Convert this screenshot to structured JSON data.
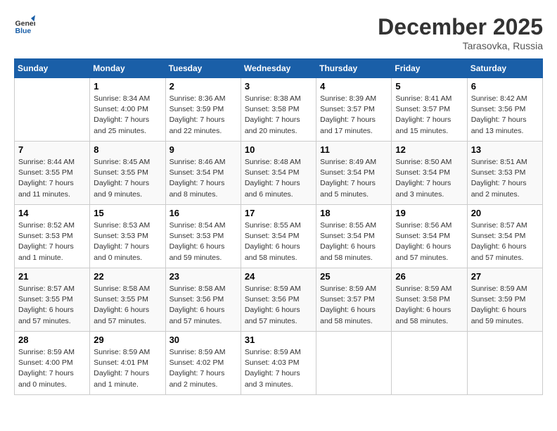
{
  "header": {
    "logo_line1": "General",
    "logo_line2": "Blue",
    "month_title": "December 2025",
    "location": "Tarasovka, Russia"
  },
  "weekdays": [
    "Sunday",
    "Monday",
    "Tuesday",
    "Wednesday",
    "Thursday",
    "Friday",
    "Saturday"
  ],
  "weeks": [
    [
      {
        "day": "",
        "sunrise": "",
        "sunset": "",
        "daylight": ""
      },
      {
        "day": "1",
        "sunrise": "Sunrise: 8:34 AM",
        "sunset": "Sunset: 4:00 PM",
        "daylight": "Daylight: 7 hours and 25 minutes."
      },
      {
        "day": "2",
        "sunrise": "Sunrise: 8:36 AM",
        "sunset": "Sunset: 3:59 PM",
        "daylight": "Daylight: 7 hours and 22 minutes."
      },
      {
        "day": "3",
        "sunrise": "Sunrise: 8:38 AM",
        "sunset": "Sunset: 3:58 PM",
        "daylight": "Daylight: 7 hours and 20 minutes."
      },
      {
        "day": "4",
        "sunrise": "Sunrise: 8:39 AM",
        "sunset": "Sunset: 3:57 PM",
        "daylight": "Daylight: 7 hours and 17 minutes."
      },
      {
        "day": "5",
        "sunrise": "Sunrise: 8:41 AM",
        "sunset": "Sunset: 3:57 PM",
        "daylight": "Daylight: 7 hours and 15 minutes."
      },
      {
        "day": "6",
        "sunrise": "Sunrise: 8:42 AM",
        "sunset": "Sunset: 3:56 PM",
        "daylight": "Daylight: 7 hours and 13 minutes."
      }
    ],
    [
      {
        "day": "7",
        "sunrise": "Sunrise: 8:44 AM",
        "sunset": "Sunset: 3:55 PM",
        "daylight": "Daylight: 7 hours and 11 minutes."
      },
      {
        "day": "8",
        "sunrise": "Sunrise: 8:45 AM",
        "sunset": "Sunset: 3:55 PM",
        "daylight": "Daylight: 7 hours and 9 minutes."
      },
      {
        "day": "9",
        "sunrise": "Sunrise: 8:46 AM",
        "sunset": "Sunset: 3:54 PM",
        "daylight": "Daylight: 7 hours and 8 minutes."
      },
      {
        "day": "10",
        "sunrise": "Sunrise: 8:48 AM",
        "sunset": "Sunset: 3:54 PM",
        "daylight": "Daylight: 7 hours and 6 minutes."
      },
      {
        "day": "11",
        "sunrise": "Sunrise: 8:49 AM",
        "sunset": "Sunset: 3:54 PM",
        "daylight": "Daylight: 7 hours and 5 minutes."
      },
      {
        "day": "12",
        "sunrise": "Sunrise: 8:50 AM",
        "sunset": "Sunset: 3:54 PM",
        "daylight": "Daylight: 7 hours and 3 minutes."
      },
      {
        "day": "13",
        "sunrise": "Sunrise: 8:51 AM",
        "sunset": "Sunset: 3:53 PM",
        "daylight": "Daylight: 7 hours and 2 minutes."
      }
    ],
    [
      {
        "day": "14",
        "sunrise": "Sunrise: 8:52 AM",
        "sunset": "Sunset: 3:53 PM",
        "daylight": "Daylight: 7 hours and 1 minute."
      },
      {
        "day": "15",
        "sunrise": "Sunrise: 8:53 AM",
        "sunset": "Sunset: 3:53 PM",
        "daylight": "Daylight: 7 hours and 0 minutes."
      },
      {
        "day": "16",
        "sunrise": "Sunrise: 8:54 AM",
        "sunset": "Sunset: 3:53 PM",
        "daylight": "Daylight: 6 hours and 59 minutes."
      },
      {
        "day": "17",
        "sunrise": "Sunrise: 8:55 AM",
        "sunset": "Sunset: 3:54 PM",
        "daylight": "Daylight: 6 hours and 58 minutes."
      },
      {
        "day": "18",
        "sunrise": "Sunrise: 8:55 AM",
        "sunset": "Sunset: 3:54 PM",
        "daylight": "Daylight: 6 hours and 58 minutes."
      },
      {
        "day": "19",
        "sunrise": "Sunrise: 8:56 AM",
        "sunset": "Sunset: 3:54 PM",
        "daylight": "Daylight: 6 hours and 57 minutes."
      },
      {
        "day": "20",
        "sunrise": "Sunrise: 8:57 AM",
        "sunset": "Sunset: 3:54 PM",
        "daylight": "Daylight: 6 hours and 57 minutes."
      }
    ],
    [
      {
        "day": "21",
        "sunrise": "Sunrise: 8:57 AM",
        "sunset": "Sunset: 3:55 PM",
        "daylight": "Daylight: 6 hours and 57 minutes."
      },
      {
        "day": "22",
        "sunrise": "Sunrise: 8:58 AM",
        "sunset": "Sunset: 3:55 PM",
        "daylight": "Daylight: 6 hours and 57 minutes."
      },
      {
        "day": "23",
        "sunrise": "Sunrise: 8:58 AM",
        "sunset": "Sunset: 3:56 PM",
        "daylight": "Daylight: 6 hours and 57 minutes."
      },
      {
        "day": "24",
        "sunrise": "Sunrise: 8:59 AM",
        "sunset": "Sunset: 3:56 PM",
        "daylight": "Daylight: 6 hours and 57 minutes."
      },
      {
        "day": "25",
        "sunrise": "Sunrise: 8:59 AM",
        "sunset": "Sunset: 3:57 PM",
        "daylight": "Daylight: 6 hours and 58 minutes."
      },
      {
        "day": "26",
        "sunrise": "Sunrise: 8:59 AM",
        "sunset": "Sunset: 3:58 PM",
        "daylight": "Daylight: 6 hours and 58 minutes."
      },
      {
        "day": "27",
        "sunrise": "Sunrise: 8:59 AM",
        "sunset": "Sunset: 3:59 PM",
        "daylight": "Daylight: 6 hours and 59 minutes."
      }
    ],
    [
      {
        "day": "28",
        "sunrise": "Sunrise: 8:59 AM",
        "sunset": "Sunset: 4:00 PM",
        "daylight": "Daylight: 7 hours and 0 minutes."
      },
      {
        "day": "29",
        "sunrise": "Sunrise: 8:59 AM",
        "sunset": "Sunset: 4:01 PM",
        "daylight": "Daylight: 7 hours and 1 minute."
      },
      {
        "day": "30",
        "sunrise": "Sunrise: 8:59 AM",
        "sunset": "Sunset: 4:02 PM",
        "daylight": "Daylight: 7 hours and 2 minutes."
      },
      {
        "day": "31",
        "sunrise": "Sunrise: 8:59 AM",
        "sunset": "Sunset: 4:03 PM",
        "daylight": "Daylight: 7 hours and 3 minutes."
      },
      {
        "day": "",
        "sunrise": "",
        "sunset": "",
        "daylight": ""
      },
      {
        "day": "",
        "sunrise": "",
        "sunset": "",
        "daylight": ""
      },
      {
        "day": "",
        "sunrise": "",
        "sunset": "",
        "daylight": ""
      }
    ]
  ]
}
